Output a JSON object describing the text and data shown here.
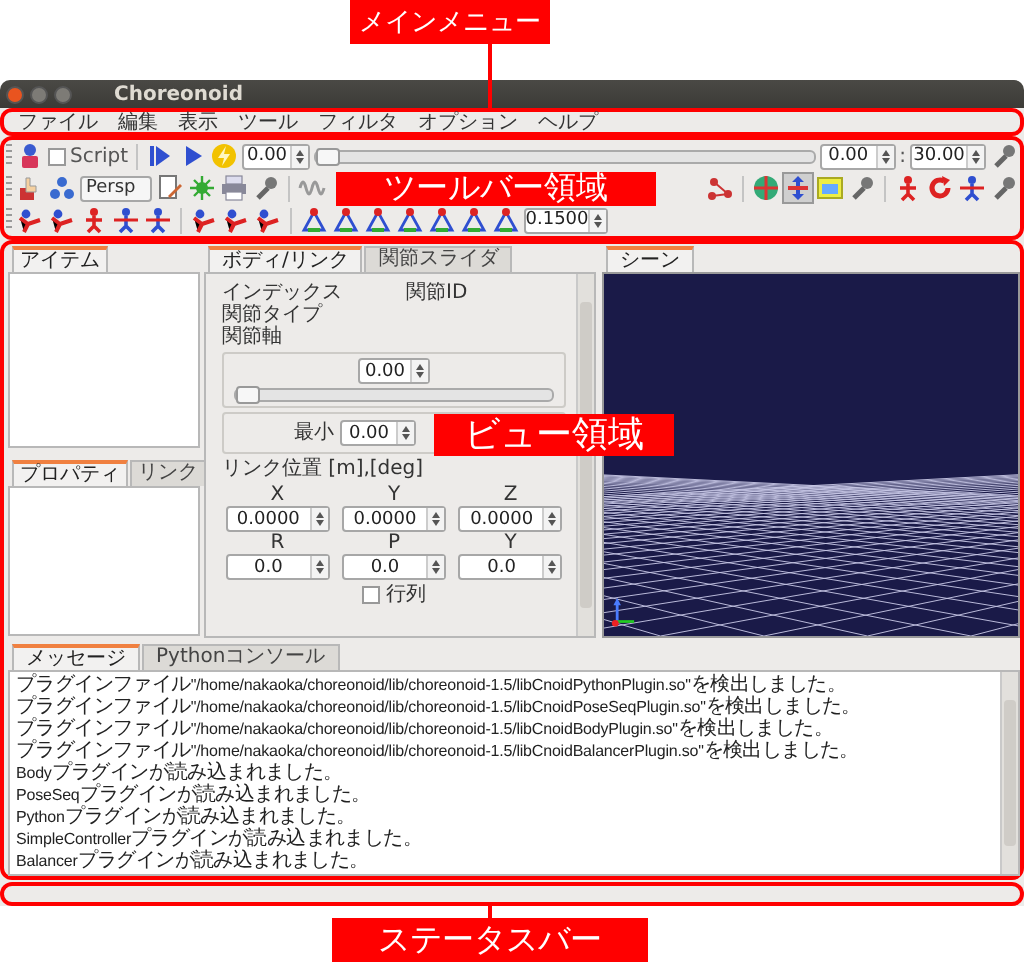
{
  "window": {
    "title": "Choreonoid"
  },
  "menu": [
    "ファイル",
    "編集",
    "表示",
    "ツール",
    "フィルタ",
    "オプション",
    "ヘルプ"
  ],
  "toolbar": {
    "script": {
      "label": "Script",
      "checked": false
    },
    "time": "0.00",
    "time_slider": {
      "level": 0
    },
    "current_time": "0.00",
    "separator": ":",
    "end_time": "30.00",
    "camera": "Persp",
    "scale": "0.1500"
  },
  "item_tabs": [
    {
      "label": "アイテム",
      "selected": true
    }
  ],
  "property_tabs": [
    {
      "label": "プロパティ",
      "selected": true
    },
    {
      "label": "リンク",
      "selected": false
    }
  ],
  "body_tabs": [
    {
      "label": "ボディ/リンク",
      "selected": true
    },
    {
      "label": "関節スライダ",
      "selected": false
    }
  ],
  "link_info": {
    "index_label": "インデックス",
    "joint_id_label": "関節ID",
    "joint_type_label": "関節タイプ",
    "joint_axis_label": "関節軸"
  },
  "joint": {
    "value": "0.00",
    "slider": {
      "level": 0
    },
    "min_label": "最小",
    "min_value": "0.00"
  },
  "link_position": {
    "title": "リンク位置 [m],[deg]",
    "fields": [
      {
        "label": "X",
        "value": "0.0000"
      },
      {
        "label": "Y",
        "value": "0.0000"
      },
      {
        "label": "Z",
        "value": "0.0000"
      },
      {
        "label": "R",
        "value": "0.0"
      },
      {
        "label": "P",
        "value": "0.0"
      },
      {
        "label": "Y",
        "value": "0.0"
      }
    ],
    "matrix": {
      "label": "行列",
      "checked": false
    }
  },
  "scene_tabs": [
    {
      "label": "シーン",
      "selected": true
    }
  ],
  "message_tabs": [
    {
      "label": "メッセージ",
      "selected": true
    },
    {
      "label": "Pythonコンソール",
      "selected": false
    }
  ],
  "messages": [
    "プラグインファイル\"/home/nakaoka/choreonoid/lib/choreonoid-1.5/libCnoidPythonPlugin.so\"を検出しました。",
    "プラグインファイル\"/home/nakaoka/choreonoid/lib/choreonoid-1.5/libCnoidPoseSeqPlugin.so\"を検出しました。",
    "プラグインファイル\"/home/nakaoka/choreonoid/lib/choreonoid-1.5/libCnoidBodyPlugin.so\"を検出しました。",
    "プラグインファイル\"/home/nakaoka/choreonoid/lib/choreonoid-1.5/libCnoidBalancerPlugin.so\"を検出しました。",
    "Bodyプラグインが読み込まれました。",
    "PoseSeqプラグインが読み込まれました。",
    "Pythonプラグインが読み込まれました。",
    "SimpleControllerプラグインが読み込まれました。",
    "Balancerプラグインが読み込まれました。"
  ],
  "annotations": [
    {
      "kind": "main_menu",
      "label": "メインメニュー"
    },
    {
      "kind": "toolbar",
      "label": "ツールバー領域"
    },
    {
      "kind": "view",
      "label": "ビュー領域"
    },
    {
      "kind": "status_bar",
      "label": "ステータスバー"
    }
  ]
}
